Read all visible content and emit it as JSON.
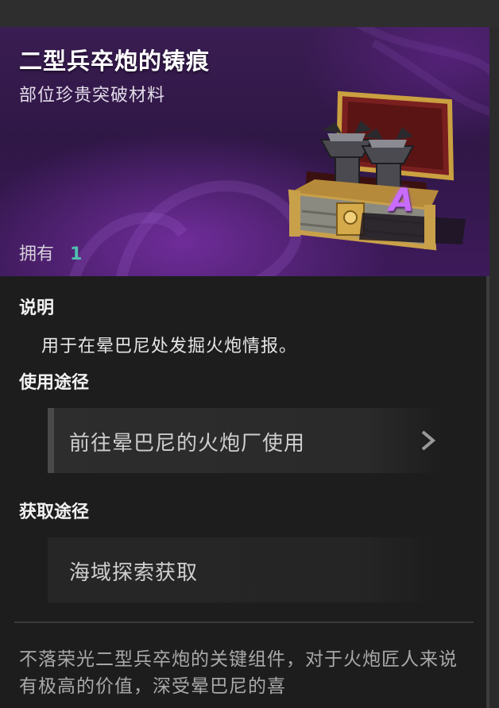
{
  "item": {
    "name": "二型兵卒炮的铸痕",
    "category": "部位珍贵突破材料",
    "owned_label": "拥有",
    "owned_count": "1",
    "rarity": "A"
  },
  "description": {
    "title": "说明",
    "text": "用于在晕巴尼处发掘火炮情报。"
  },
  "usage": {
    "title": "使用途径",
    "button_label": "前往晕巴尼的火炮厂使用"
  },
  "acquire": {
    "title": "获取途径",
    "source_label": "海域探索获取"
  },
  "lore": "不落荣光二型兵卒炮的关键组件，对于火炮匠人来说有极高的价值，深受晕巴尼的喜",
  "colors": {
    "header_purple": "#3a1d52",
    "owned_count": "#4fc0b0",
    "rarity": "#c86bff",
    "panel_bg": "#1d1d1d"
  }
}
